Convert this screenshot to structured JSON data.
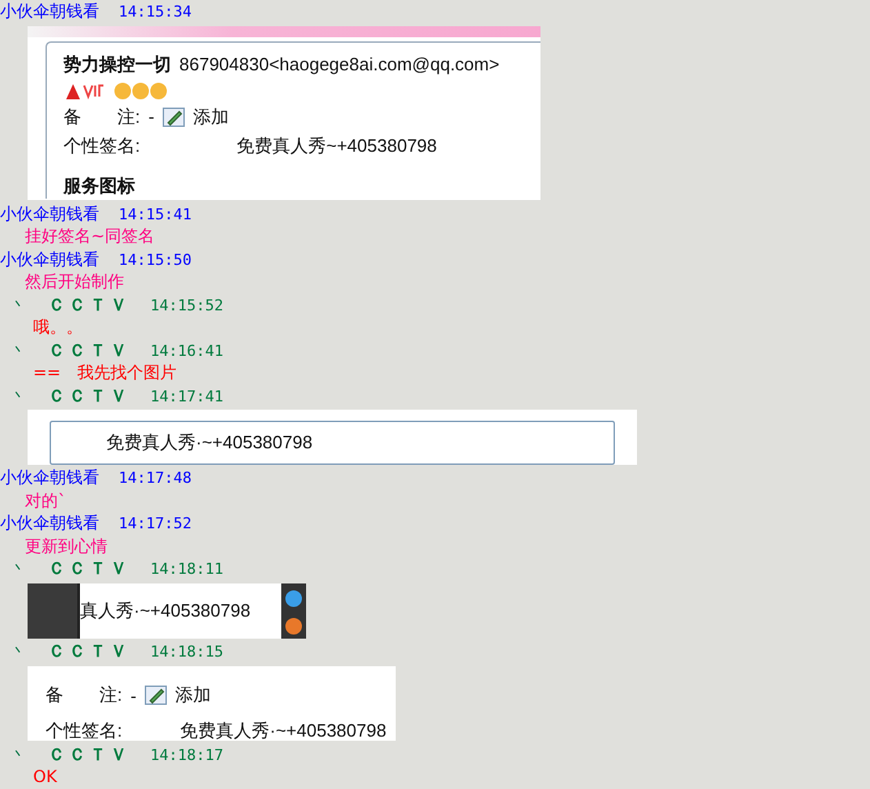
{
  "chat_log": [
    {
      "kind": "buddy-header",
      "sender": "小伙伞朝钱看",
      "time": "14:15:34"
    },
    {
      "kind": "profile-shot",
      "name": "势力操控一切",
      "account": "867904830<haogege8ai.com@qq.com>",
      "remark_label": "备　　注:",
      "remark_value": "-",
      "add_label": "添加",
      "signature_label": "个性签名:",
      "signature": "免费真人秀~+405380798",
      "section": "服务图标"
    },
    {
      "kind": "buddy-header",
      "sender": "小伙伞朝钱看",
      "time": "14:15:41"
    },
    {
      "kind": "text",
      "text": "挂好签名~同签名",
      "color": "#ff0080"
    },
    {
      "kind": "buddy-header",
      "sender": "小伙伞朝钱看",
      "time": "14:15:50"
    },
    {
      "kind": "text",
      "text": "然后开始制作",
      "color": "#ff0080"
    },
    {
      "kind": "cctv-header",
      "prefix": "丶",
      "sender": "ＣＣＴＶ",
      "time": "14:15:52"
    },
    {
      "kind": "text",
      "text": "哦。。",
      "color": "#ff0000"
    },
    {
      "kind": "cctv-header",
      "prefix": "丶",
      "sender": "ＣＣＴＶ",
      "time": "14:16:41"
    },
    {
      "kind": "text",
      "text": "==　我先找个图片",
      "color": "#ff0000"
    },
    {
      "kind": "cctv-header",
      "prefix": "丶",
      "sender": "ＣＣＴＶ",
      "time": "14:17:41"
    },
    {
      "kind": "signature-shot",
      "signature": "免费真人秀·~+405380798"
    },
    {
      "kind": "buddy-header",
      "sender": "小伙伞朝钱看",
      "time": "14:17:48"
    },
    {
      "kind": "text",
      "text": "对的`",
      "color": "#ff0080"
    },
    {
      "kind": "buddy-header",
      "sender": "小伙伞朝钱看",
      "time": "14:17:52"
    },
    {
      "kind": "text",
      "text": "更新到心情",
      "color": "#ff0080"
    },
    {
      "kind": "cctv-header",
      "prefix": "丶",
      "sender": "ＣＣＴＶ",
      "time": "14:18:11"
    },
    {
      "kind": "cropped-shot",
      "signature": "真人秀·~+405380798"
    },
    {
      "kind": "cctv-header",
      "prefix": "丶",
      "sender": "ＣＣＴＶ",
      "time": "14:18:15"
    },
    {
      "kind": "remark-shot",
      "remark_label": "备　　注:",
      "remark_value": "-",
      "add_label": "添加",
      "signature_label": "个性签名:",
      "signature": "免费真人秀·~+405380798"
    },
    {
      "kind": "cctv-header",
      "prefix": "丶",
      "sender": "ＣＣＴＶ",
      "time": "14:18:17"
    },
    {
      "kind": "text",
      "text": "OK",
      "color": "#ff0000"
    }
  ]
}
